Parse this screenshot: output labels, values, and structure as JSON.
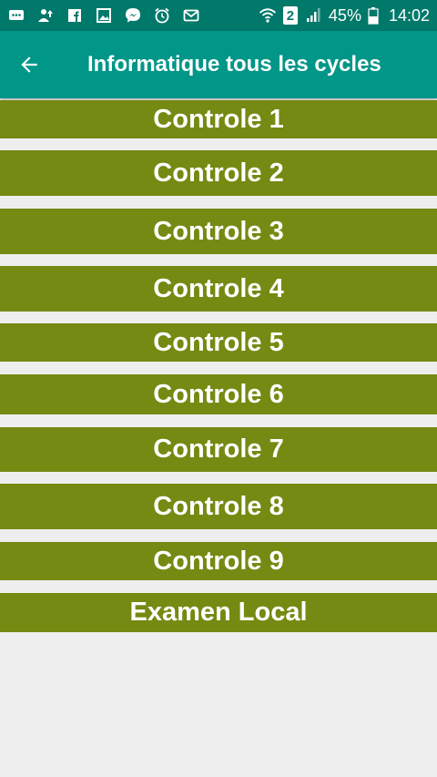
{
  "status_bar": {
    "battery_percent": "45%",
    "time": "14:02",
    "sim_slot": "2",
    "icons": [
      "chat-icon",
      "upload-icon",
      "facebook-icon",
      "gallery-icon",
      "messenger-icon",
      "alarm-icon",
      "mail-icon",
      "wifi-icon",
      "sim-icon",
      "signal-icon",
      "battery-icon"
    ]
  },
  "app_bar": {
    "back_icon": "arrow-left-icon",
    "title": "Informatique tous les cycles"
  },
  "items": [
    {
      "label": "Controle 1"
    },
    {
      "label": "Controle 2"
    },
    {
      "label": "Controle 3"
    },
    {
      "label": "Controle 4"
    },
    {
      "label": "Controle 5"
    },
    {
      "label": "Controle 6"
    },
    {
      "label": "Controle 7"
    },
    {
      "label": "Controle 8"
    },
    {
      "label": "Controle 9"
    },
    {
      "label": "Examen Local"
    }
  ],
  "colors": {
    "status_bar": "#00796b",
    "app_bar": "#009688",
    "item_background": "#748a12",
    "page_background": "#eeeeee"
  }
}
